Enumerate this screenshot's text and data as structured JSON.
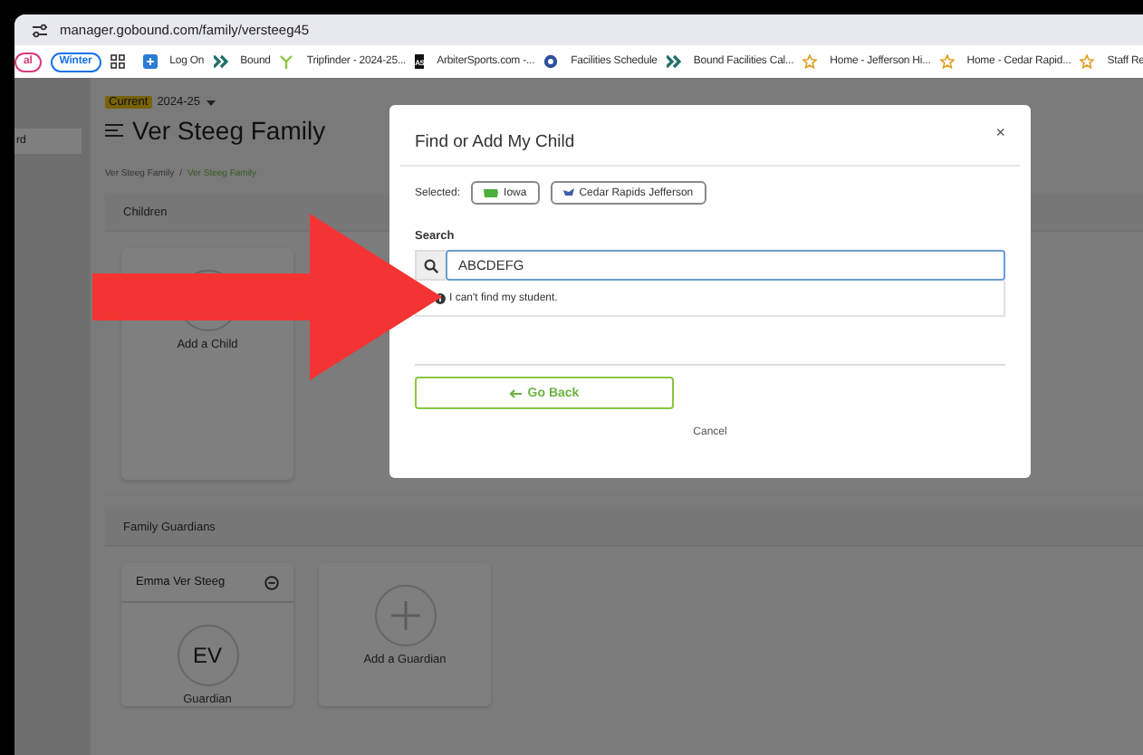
{
  "browser": {
    "url": "manager.gobound.com/family/versteeg45",
    "tab_groups": [
      {
        "label": "al",
        "color": "#d93a7a"
      },
      {
        "label": "Winter",
        "color": "#1a73e8"
      }
    ],
    "bookmarks": [
      {
        "label": "Log On",
        "kind": "square"
      },
      {
        "label": "Bound",
        "kind": "chevron"
      },
      {
        "label": "Tripfinder - 2024-25...",
        "kind": "fork"
      },
      {
        "label": "ArbiterSports.com -...",
        "kind": "badge",
        "icon_text": "AS"
      },
      {
        "label": "Facilities Schedule",
        "kind": "circle"
      },
      {
        "label": "Bound Facilities Cal...",
        "kind": "chevron"
      },
      {
        "label": "Home - Jefferson Hi...",
        "kind": "star"
      },
      {
        "label": "Home - Cedar Rapid...",
        "kind": "star"
      },
      {
        "label": "Staff Re",
        "kind": "star"
      }
    ]
  },
  "sidebar": {
    "items": [
      {
        "label": "rd",
        "selected": true
      }
    ]
  },
  "page": {
    "season": {
      "badge": "Current",
      "year": "2024-25"
    },
    "title": "Ver Steeg Family",
    "breadcrumb": {
      "items": [
        "Ver Steeg Family",
        "Ver Steeg Family"
      ],
      "separator": "/"
    },
    "sections": [
      {
        "title": "Children",
        "cards": [
          {
            "kind": "add",
            "label": "Add a Child"
          }
        ]
      },
      {
        "title": "Family Guardians",
        "cards": [
          {
            "kind": "person",
            "name": "Emma Ver Steeg",
            "initials": "EV",
            "role": "Guardian"
          },
          {
            "kind": "add",
            "label": "Add a Guardian"
          }
        ]
      }
    ]
  },
  "modal": {
    "title": "Find or Add My Child",
    "close": "×",
    "selected_label": "Selected:",
    "chips": [
      {
        "label": "Iowa",
        "kind": "state"
      },
      {
        "label": "Cedar Rapids Jefferson",
        "kind": "school"
      }
    ],
    "search": {
      "label": "Search",
      "value": "ABCDEFG"
    },
    "results": [
      "I can't find my student."
    ],
    "go_back": "Go Back",
    "cancel": "Cancel"
  }
}
